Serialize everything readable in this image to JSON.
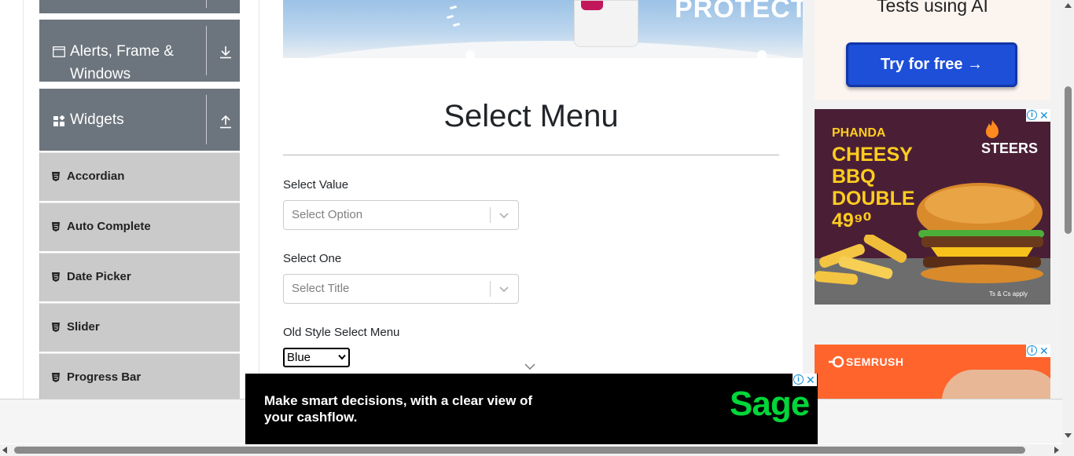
{
  "sidebar": {
    "groups": [
      {
        "label_line1": "Alerts, Frame &",
        "label_line2": "Windows",
        "icon": "window-icon",
        "arrow": "download-icon"
      },
      {
        "label_line1": "Widgets",
        "icon": "widgets-icon",
        "arrow": "upload-icon"
      }
    ],
    "items": [
      {
        "label": "Accordian",
        "icon": "html5-icon"
      },
      {
        "label": "Auto Complete",
        "icon": "html5-icon"
      },
      {
        "label": "Date Picker",
        "icon": "html5-icon"
      },
      {
        "label": "Slider",
        "icon": "html5-icon"
      },
      {
        "label": "Progress Bar",
        "icon": "html5-icon"
      }
    ]
  },
  "banner": {
    "headline": "PROTECT"
  },
  "main": {
    "title": "Select Menu",
    "select_value": {
      "label": "Select Value",
      "placeholder": "Select Option"
    },
    "select_one": {
      "label": "Select One",
      "placeholder": "Select Title"
    },
    "old_style": {
      "label": "Old Style Select Menu",
      "value": "Blue"
    }
  },
  "ads": {
    "top_right": {
      "headline": "Tests using AI",
      "button": "Try for free →"
    },
    "burger": {
      "brand": "PHANDA",
      "headline": "CHEESY BBQ DOUBLE 49⁹⁰",
      "logo": "STEERS",
      "fine_print": "Ts & Cs apply"
    },
    "semrush": {
      "logo": "SEMRUSH"
    },
    "bottom": {
      "message": "Make smart decisions, with a clear view of your cashflow.",
      "logo": "Sage"
    },
    "info_glyph": "i",
    "close_glyph": "✕"
  },
  "colors": {
    "sidebar_group": "#6c757d",
    "sidebar_item": "#cacaca",
    "ad_button": "#1d4fd8",
    "sage_green": "#00d639",
    "semrush_orange": "#ff642d"
  }
}
